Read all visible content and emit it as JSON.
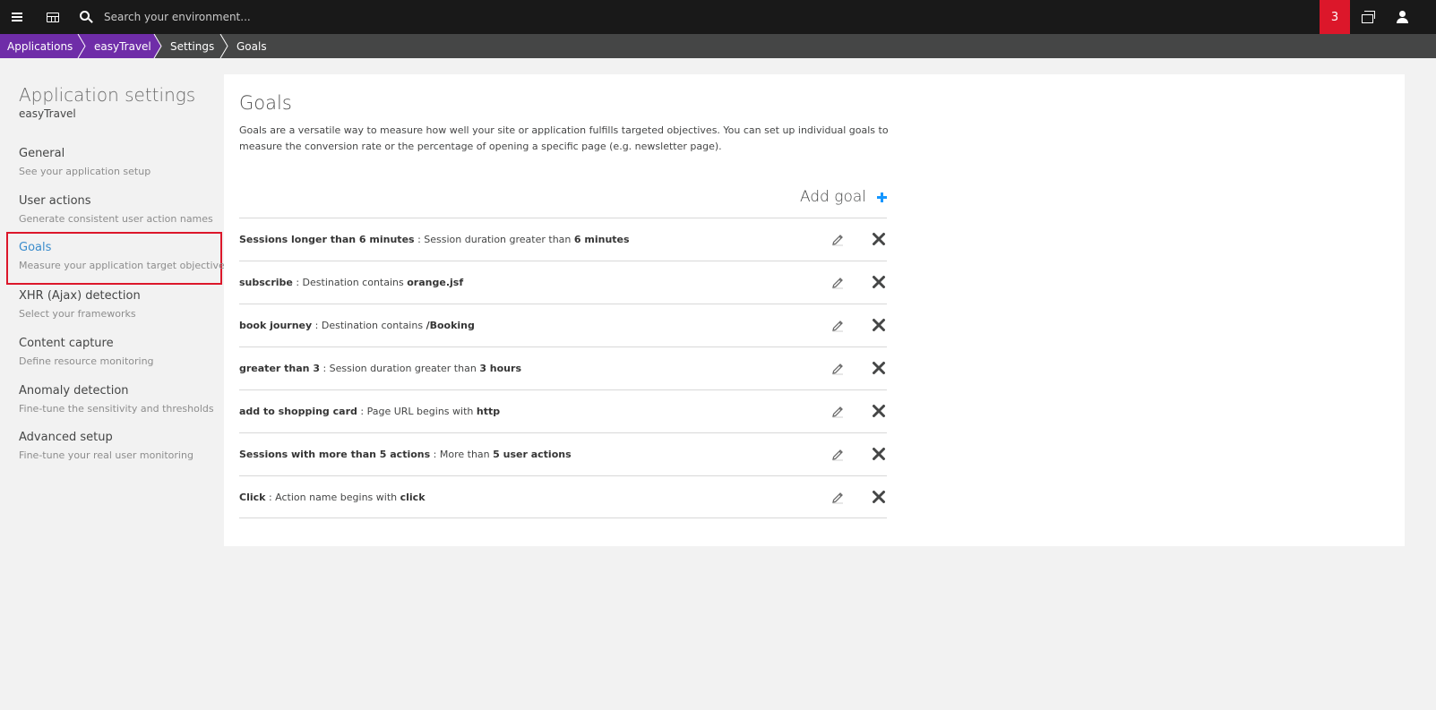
{
  "topbar": {
    "search_placeholder": "Search your environment...",
    "problem_count": "3",
    "icons": [
      "menu-icon",
      "dashboard-icon",
      "search-icon",
      "windows-icon",
      "user-icon"
    ],
    "problem_color": "#dc172a"
  },
  "breadcrumb": {
    "items": [
      "Applications",
      "easyTravel",
      "Settings",
      "Goals"
    ],
    "accent_color": "#6f2da8"
  },
  "sidebar": {
    "title": "Application settings",
    "subtitle": "easyTravel",
    "items": [
      {
        "label": "General",
        "desc": "See your application setup"
      },
      {
        "label": "User actions",
        "desc": "Generate consistent user action names"
      },
      {
        "label": "Goals",
        "desc": "Measure your application target objectives"
      },
      {
        "label": "XHR (Ajax) detection",
        "desc": "Select your frameworks"
      },
      {
        "label": "Content capture",
        "desc": "Define resource monitoring"
      },
      {
        "label": "Anomaly detection",
        "desc": "Fine-tune the sensitivity and thresholds"
      },
      {
        "label": "Advanced setup",
        "desc": "Fine-tune your real user monitoring"
      }
    ],
    "active_item": "Goals"
  },
  "main": {
    "title": "Goals",
    "description": "Goals are a versatile way to measure how well your site or application fulfills targeted objectives. You can set up individual goals to measure the conversion rate or the percentage of opening a specific page (e.g. newsletter page).",
    "add_goal_label": "Add goal",
    "goals": [
      {
        "name": "Sessions longer than 6 minutes",
        "condition": " : Session duration greater than ",
        "value": "6 minutes"
      },
      {
        "name": "subscribe",
        "condition": " : Destination contains ",
        "value": "orange.jsf"
      },
      {
        "name": "book journey",
        "condition": " : Destination contains ",
        "value": "/Booking"
      },
      {
        "name": "greater than 3",
        "condition": " : Session duration greater than ",
        "value": "3 hours"
      },
      {
        "name": "add to shopping card",
        "condition": " : Page URL begins with ",
        "value": "http"
      },
      {
        "name": "Sessions with more than 5 actions",
        "condition": " : More than ",
        "value": "5 user actions"
      },
      {
        "name": "Click",
        "condition": " : Action name begins with ",
        "value": "click"
      }
    ]
  }
}
